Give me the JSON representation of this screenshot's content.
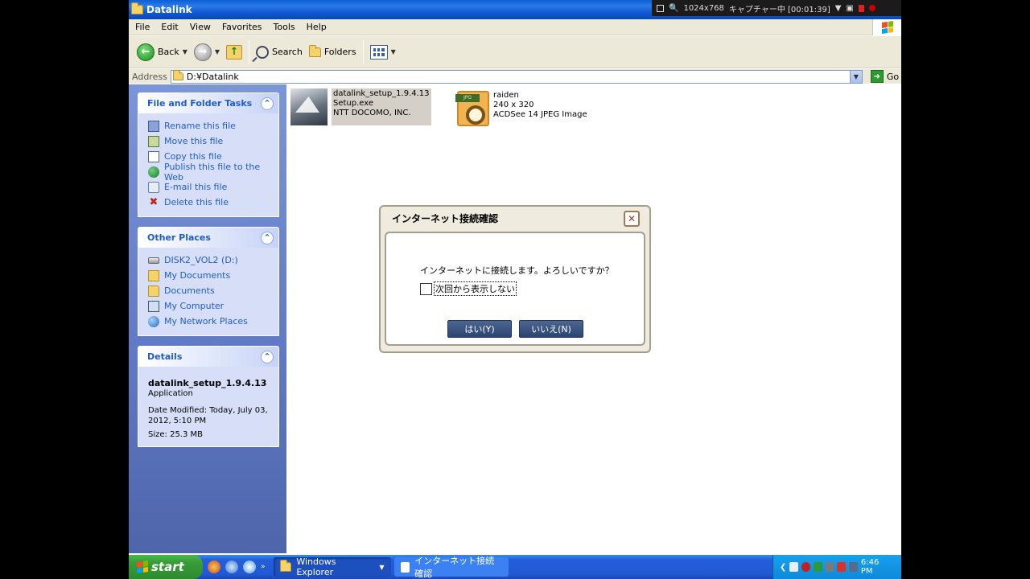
{
  "window": {
    "title": "Datalink"
  },
  "capture": {
    "resolution": "1024x768",
    "status": "キャプチャー中 [00:01:39]"
  },
  "menu": [
    "File",
    "Edit",
    "View",
    "Favorites",
    "Tools",
    "Help"
  ],
  "toolbar": {
    "back": "Back",
    "search": "Search",
    "folders": "Folders"
  },
  "address": {
    "label": "Address",
    "value": "D:¥Datalink",
    "go": "Go"
  },
  "tasks_panel": {
    "title": "File and Folder Tasks",
    "items": [
      {
        "label": "Rename this file",
        "icon": "rename-icon"
      },
      {
        "label": "Move this file",
        "icon": "move-icon"
      },
      {
        "label": "Copy this file",
        "icon": "copy-icon"
      },
      {
        "label": "Publish this file to the Web",
        "icon": "web-icon"
      },
      {
        "label": "E-mail this file",
        "icon": "mail-icon"
      },
      {
        "label": "Delete this file",
        "icon": "delete-icon"
      }
    ]
  },
  "places_panel": {
    "title": "Other Places",
    "items": [
      {
        "label": "DISK2_VOL2 (D:)",
        "icon": "drive-icon"
      },
      {
        "label": "My Documents",
        "icon": "my-documents-icon"
      },
      {
        "label": "Documents",
        "icon": "folder-icon"
      },
      {
        "label": "My Computer",
        "icon": "computer-icon"
      },
      {
        "label": "My Network Places",
        "icon": "network-icon"
      }
    ]
  },
  "details_panel": {
    "title": "Details",
    "name": "datalink_setup_1.9.4.13",
    "type": "Application",
    "modified": "Date Modified: Today, July 03, 2012, 5:10 PM",
    "size": "Size: 25.3 MB"
  },
  "files": [
    {
      "line1": "datalink_setup_1.9.4.13",
      "line2": "Setup.exe",
      "line3": "NTT DOCOMO, INC."
    },
    {
      "line1": "raiden",
      "line2": "240 x 320",
      "line3": "ACDSee 14 JPEG Image",
      "tag": "JPG"
    }
  ],
  "dialog": {
    "title": "インターネット接続確認",
    "message": "インターネットに接続します。よろしいですか？",
    "checkbox": "次回から表示しない",
    "yes": "はい(Y)",
    "no": "いいえ(N)"
  },
  "taskbar": {
    "start": "start",
    "tasks": [
      "Windows Explorer",
      "インターネット接続確認"
    ],
    "clock": "6:46 PM"
  }
}
